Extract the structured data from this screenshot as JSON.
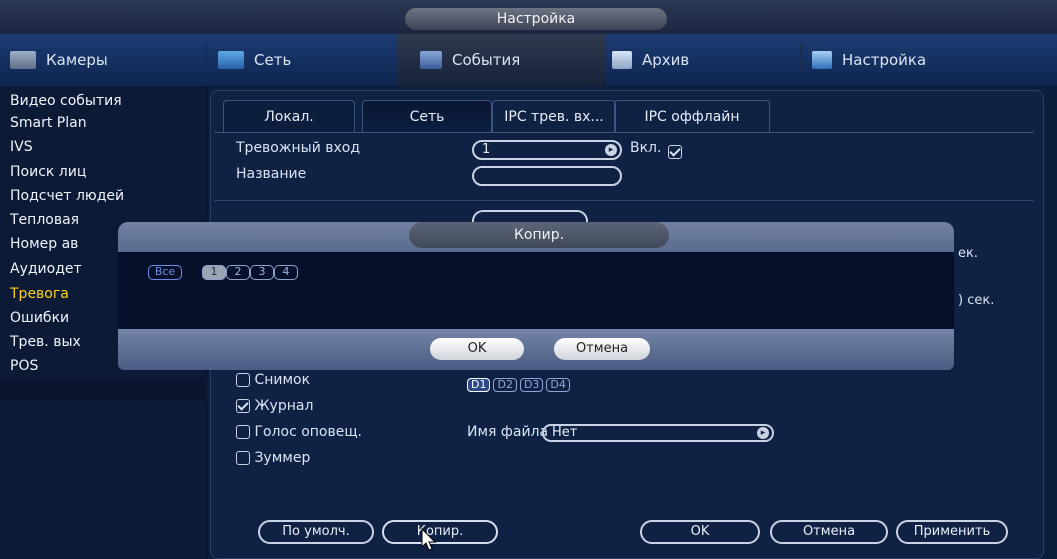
{
  "window": {
    "title": "Настройка"
  },
  "topnav": [
    {
      "label": "Камеры",
      "icon": "camera-icon"
    },
    {
      "label": "Сеть",
      "icon": "network-icon"
    },
    {
      "label": "События",
      "icon": "events-icon"
    },
    {
      "label": "Архив",
      "icon": "archive-icon"
    },
    {
      "label": "Настройка",
      "icon": "settings-icon"
    }
  ],
  "sidebar": {
    "items": [
      "Видео события",
      "Smart Plan",
      "IVS",
      "Поиск лиц",
      "Подсчет людей",
      "Тепловая",
      "Номер ав",
      "Аудиодет",
      "Тревога",
      "Ошибки",
      "Трев. вых",
      "POS"
    ],
    "active": "Тревога"
  },
  "subtabs": [
    "Локал.",
    "Сеть",
    "IPC трев. вх...",
    "IPC оффлайн"
  ],
  "form": {
    "alarm_input_label": "Тревожный вход",
    "alarm_input_value": "1",
    "enable_label": "Вкл.",
    "name_label": "Название",
    "name_value": "",
    "sec_label_1": "ек.",
    "sec_label_2": ") сек.",
    "snapshot_label": "Снимок",
    "snapshot_channels": [
      "D1",
      "D2",
      "D3",
      "D4"
    ],
    "journal_label": "Журнал",
    "voice_label": "Голос оповещ.",
    "filename_label": "Имя файла",
    "filename_value": "Нет",
    "buzzer_label": "Зуммер"
  },
  "bottom_buttons": {
    "default": "По умолч.",
    "copy": "Копир.",
    "ok": "OK",
    "cancel": "Отмена",
    "apply": "Применить"
  },
  "dialog": {
    "title": "Копир.",
    "all_label": "Все",
    "channels": [
      "1",
      "2",
      "3",
      "4"
    ],
    "ok": "OK",
    "cancel": "Отмена"
  }
}
